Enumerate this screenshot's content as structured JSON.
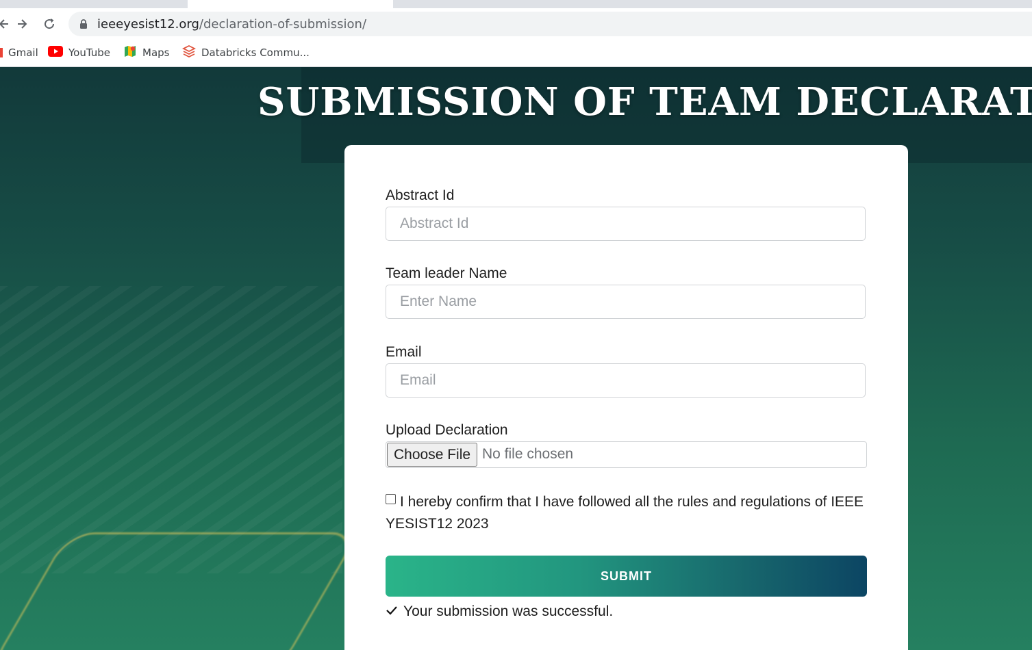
{
  "browser": {
    "url_domain": "ieeeyesist12.org",
    "url_path": "/declaration-of-submission/",
    "bookmarks": [
      {
        "label": "Gmail",
        "icon": "gmail-icon"
      },
      {
        "label": "YouTube",
        "icon": "youtube-icon"
      },
      {
        "label": "Maps",
        "icon": "maps-icon"
      },
      {
        "label": "Databricks Commu...",
        "icon": "databricks-icon"
      }
    ]
  },
  "page": {
    "title": "SUBMISSION OF TEAM DECLARATION"
  },
  "form": {
    "abstract_id": {
      "label": "Abstract Id",
      "placeholder": "Abstract Id",
      "value": ""
    },
    "team_leader": {
      "label": "Team leader Name",
      "placeholder": "Enter Name",
      "value": ""
    },
    "email": {
      "label": "Email",
      "placeholder": "Email",
      "value": ""
    },
    "upload": {
      "label": "Upload Declaration",
      "button_label": "Choose File",
      "status": "No file chosen"
    },
    "confirm": {
      "checked": false,
      "label": "I hereby confirm that I have followed all the rules and regulations of IEEE YESIST12 2023"
    },
    "submit_label": "SUBMIT",
    "success_message": "Your submission was successful."
  },
  "colors": {
    "submit_gradient_start": "#2ab489",
    "submit_gradient_end": "#0c4563",
    "hero_dark": "#12393a",
    "hero_light": "#258060"
  }
}
